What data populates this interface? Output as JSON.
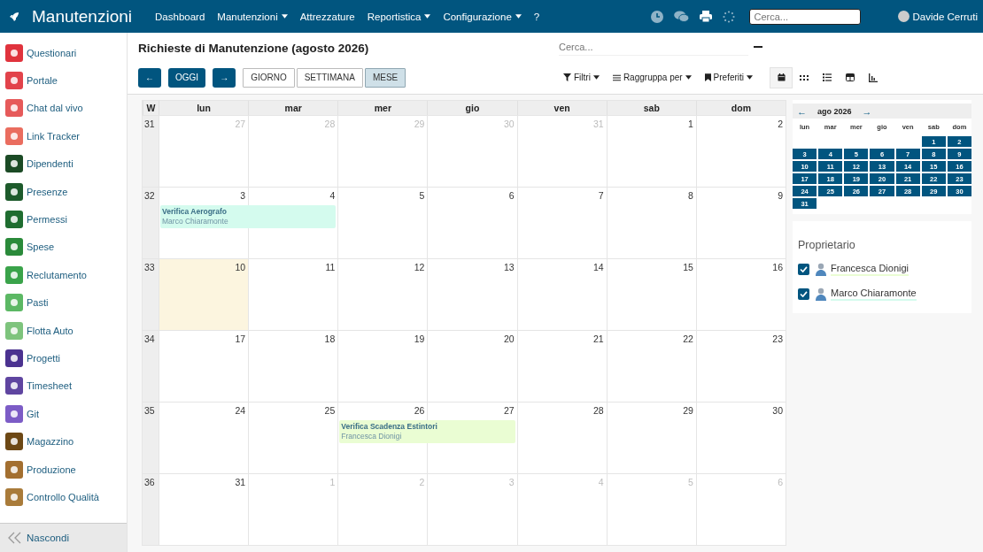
{
  "navbar": {
    "brand": "Manutenzioni",
    "menu": [
      {
        "label": "Dashboard",
        "dropdown": false
      },
      {
        "label": "Manutenzioni",
        "dropdown": true
      },
      {
        "label": "Attrezzature",
        "dropdown": false
      },
      {
        "label": "Reportistica",
        "dropdown": true
      },
      {
        "label": "Configurazione",
        "dropdown": true
      },
      {
        "label": "?",
        "dropdown": false
      }
    ],
    "search": {
      "placeholder": "Cerca..."
    },
    "user": "Davide Cerruti"
  },
  "sidebar": {
    "items": [
      {
        "label": "Questionari",
        "color": "#e0333d"
      },
      {
        "label": "Portale",
        "color": "#e2434b"
      },
      {
        "label": "Chat dal vivo",
        "color": "#e65a5a"
      },
      {
        "label": "Link Tracker",
        "color": "#ea6d5f"
      },
      {
        "label": "Dipendenti",
        "color": "#1b4a25"
      },
      {
        "label": "Presenze",
        "color": "#1d5a2b"
      },
      {
        "label": "Permessi",
        "color": "#1f6d30"
      },
      {
        "label": "Spese",
        "color": "#2a8a3a"
      },
      {
        "label": "Reclutamento",
        "color": "#3aa34a"
      },
      {
        "label": "Pasti",
        "color": "#5cb864"
      },
      {
        "label": "Flotta Auto",
        "color": "#7ec47d"
      },
      {
        "label": "Progetti",
        "color": "#4b3290"
      },
      {
        "label": "Timesheet",
        "color": "#5f45a0"
      },
      {
        "label": "Git",
        "color": "#7c5cc6"
      },
      {
        "label": "Magazzino",
        "color": "#6d4815"
      },
      {
        "label": "Produzione",
        "color": "#a36f30"
      },
      {
        "label": "Controllo Qualità",
        "color": "#a97b3a"
      }
    ],
    "hide_label": "Nascondi"
  },
  "control_panel": {
    "title": "Richieste di Manutenzione (agosto 2026)",
    "search": {
      "placeholder": "Cerca..."
    },
    "nav_buttons": [
      {
        "label": "←"
      },
      {
        "label": "OGGI"
      },
      {
        "label": "→"
      }
    ],
    "scale_buttons": [
      {
        "label": "GIORNO",
        "selected": false
      },
      {
        "label": "SETTIMANA",
        "selected": false
      },
      {
        "label": "MESE",
        "selected": true
      }
    ],
    "filters": [
      {
        "label": "Filtri",
        "kind": "filter"
      },
      {
        "label": "Raggruppa per",
        "kind": "group"
      },
      {
        "label": "Preferiti",
        "kind": "favorite"
      }
    ],
    "views": [
      {
        "kind": "calendar",
        "selected": true
      },
      {
        "kind": "kanban",
        "selected": false
      },
      {
        "kind": "list",
        "selected": false
      },
      {
        "kind": "pivot",
        "selected": false
      },
      {
        "kind": "graph",
        "selected": false
      }
    ]
  },
  "calendar": {
    "week_label": "W",
    "weekdays": [
      "lun",
      "mar",
      "mer",
      "gio",
      "ven",
      "sab",
      "dom"
    ],
    "weeks": [
      {
        "number": "31",
        "days": [
          {
            "label": "27",
            "other_month": true,
            "today": false
          },
          {
            "label": "28",
            "other_month": true,
            "today": false
          },
          {
            "label": "29",
            "other_month": true,
            "today": false
          },
          {
            "label": "30",
            "other_month": true,
            "today": false
          },
          {
            "label": "31",
            "other_month": true,
            "today": false
          },
          {
            "label": "1",
            "other_month": false,
            "today": false
          },
          {
            "label": "2",
            "other_month": false,
            "today": false
          }
        ]
      },
      {
        "number": "32",
        "days": [
          {
            "label": "3",
            "other_month": false,
            "today": false,
            "event": {
              "kind": "start",
              "title": "Verifica Aerografo",
              "owner": "Marco Chiaramonte",
              "color": "#d4fbee"
            }
          },
          {
            "label": "4",
            "other_month": false,
            "today": false,
            "event": {
              "kind": "continue"
            }
          },
          {
            "label": "5",
            "other_month": false,
            "today": false
          },
          {
            "label": "6",
            "other_month": false,
            "today": false
          },
          {
            "label": "7",
            "other_month": false,
            "today": false
          },
          {
            "label": "8",
            "other_month": false,
            "today": false
          },
          {
            "label": "9",
            "other_month": false,
            "today": false
          }
        ]
      },
      {
        "number": "33",
        "days": [
          {
            "label": "10",
            "other_month": false,
            "today": true
          },
          {
            "label": "11",
            "other_month": false,
            "today": false
          },
          {
            "label": "12",
            "other_month": false,
            "today": false
          },
          {
            "label": "13",
            "other_month": false,
            "today": false
          },
          {
            "label": "14",
            "other_month": false,
            "today": false
          },
          {
            "label": "15",
            "other_month": false,
            "today": false
          },
          {
            "label": "16",
            "other_month": false,
            "today": false
          }
        ]
      },
      {
        "number": "34",
        "days": [
          {
            "label": "17",
            "other_month": false,
            "today": false
          },
          {
            "label": "18",
            "other_month": false,
            "today": false
          },
          {
            "label": "19",
            "other_month": false,
            "today": false
          },
          {
            "label": "20",
            "other_month": false,
            "today": false
          },
          {
            "label": "21",
            "other_month": false,
            "today": false
          },
          {
            "label": "22",
            "other_month": false,
            "today": false
          },
          {
            "label": "23",
            "other_month": false,
            "today": false
          }
        ]
      },
      {
        "number": "35",
        "days": [
          {
            "label": "24",
            "other_month": false,
            "today": false
          },
          {
            "label": "25",
            "other_month": false,
            "today": false
          },
          {
            "label": "26",
            "other_month": false,
            "today": false,
            "event": {
              "kind": "start",
              "title": "Verifica Scadenza Estintori",
              "owner": "Francesca Dionigi",
              "color": "#eafdd3"
            }
          },
          {
            "label": "27",
            "other_month": false,
            "today": false,
            "event": {
              "kind": "continue"
            }
          },
          {
            "label": "28",
            "other_month": false,
            "today": false
          },
          {
            "label": "29",
            "other_month": false,
            "today": false
          },
          {
            "label": "30",
            "other_month": false,
            "today": false
          }
        ]
      },
      {
        "number": "36",
        "days": [
          {
            "label": "31",
            "other_month": false,
            "today": false
          },
          {
            "label": "1",
            "other_month": true,
            "today": false
          },
          {
            "label": "2",
            "other_month": true,
            "today": false
          },
          {
            "label": "3",
            "other_month": true,
            "today": false
          },
          {
            "label": "4",
            "other_month": true,
            "today": false
          },
          {
            "label": "5",
            "other_month": true,
            "today": false
          },
          {
            "label": "6",
            "other_month": true,
            "today": false
          }
        ]
      }
    ]
  },
  "mini_calendar": {
    "prev": "←",
    "month": "ago 2026",
    "next": "→",
    "weekdays": [
      "lun",
      "mar",
      "mer",
      "gio",
      "ven",
      "sab",
      "dom"
    ],
    "weeks": [
      {
        "kind": "partial-start",
        "days": [
          "1",
          "2"
        ]
      },
      {
        "kind": "full",
        "days": [
          "3",
          "4",
          "5",
          "6",
          "7",
          "8",
          "9"
        ]
      },
      {
        "kind": "full",
        "days": [
          "10",
          "11",
          "12",
          "13",
          "14",
          "15",
          "16"
        ]
      },
      {
        "kind": "full",
        "days": [
          "17",
          "18",
          "19",
          "20",
          "21",
          "22",
          "23"
        ]
      },
      {
        "kind": "full",
        "days": [
          "24",
          "25",
          "26",
          "27",
          "28",
          "29",
          "30"
        ]
      },
      {
        "kind": "partial-end",
        "days": [
          "31"
        ]
      }
    ]
  },
  "owners": {
    "title": "Proprietario",
    "items": [
      {
        "name": "Francesca Dionigi",
        "checked": true,
        "color": "#eafdd3"
      },
      {
        "name": "Marco Chiaramonte",
        "checked": true,
        "color": "#d4fbee"
      }
    ]
  }
}
